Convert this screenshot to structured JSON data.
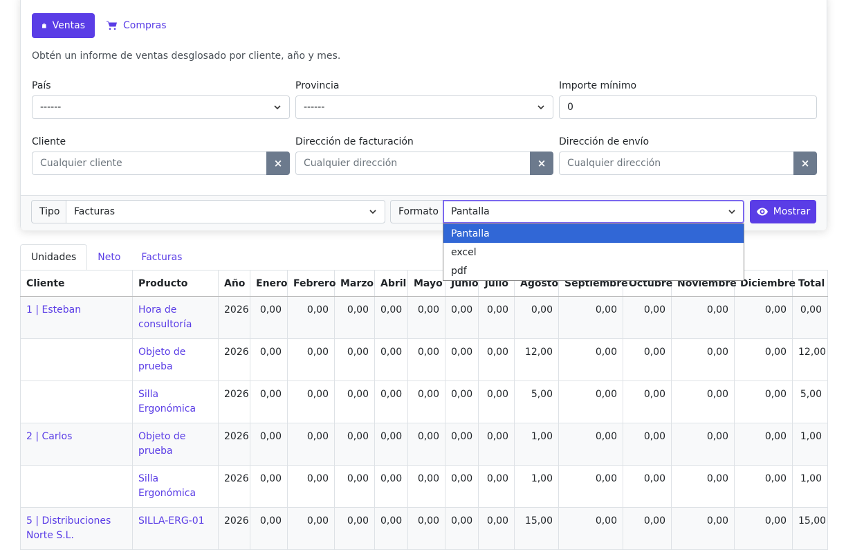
{
  "toolbar": {
    "sales_label": "Ventas",
    "purchases_label": "Compras"
  },
  "description": "Obtén un informe de ventas desglosado por cliente, año y mes.",
  "filters": {
    "country": {
      "label": "País",
      "value": "------"
    },
    "province": {
      "label": "Provincia",
      "value": "------"
    },
    "min_amount": {
      "label": "Importe mínimo",
      "value": "0"
    },
    "customer": {
      "label": "Cliente",
      "placeholder": "Cualquier cliente"
    },
    "billing_address": {
      "label": "Dirección de facturación",
      "placeholder": "Cualquier dirección"
    },
    "shipping_address": {
      "label": "Dirección de envío",
      "placeholder": "Cualquier dirección"
    },
    "clear_symbol": "×"
  },
  "options_bar": {
    "type_label": "Tipo",
    "type_value": "Facturas",
    "format_label": "Formato",
    "format_value": "Pantalla",
    "show_label": "Mostrar",
    "format_options": [
      "Pantalla",
      "excel",
      "pdf"
    ]
  },
  "tabs": [
    "Unidades",
    "Neto",
    "Facturas"
  ],
  "table": {
    "headers": [
      "Cliente",
      "Producto",
      "Año",
      "Enero",
      "Febrero",
      "Marzo",
      "Abril",
      "Mayo",
      "Junio",
      "Julio",
      "Agosto",
      "Septiembre",
      "Octubre",
      "Noviembre",
      "Diciembre",
      "Total"
    ],
    "rows": [
      {
        "cliente": "1 | Esteban",
        "producto": "Hora de consultoría",
        "year": "2026",
        "months": [
          "0,00",
          "0,00",
          "0,00",
          "0,00",
          "0,00",
          "0,00",
          "0,00",
          "0,00",
          "0,00",
          "0,00",
          "0,00",
          "0,00"
        ],
        "total": "0,00"
      },
      {
        "cliente": "",
        "producto": "Objeto de prueba",
        "year": "2026",
        "months": [
          "0,00",
          "0,00",
          "0,00",
          "0,00",
          "0,00",
          "0,00",
          "0,00",
          "12,00",
          "0,00",
          "0,00",
          "0,00",
          "0,00"
        ],
        "total": "12,00"
      },
      {
        "cliente": "",
        "producto": "Silla Ergonómica",
        "year": "2026",
        "months": [
          "0,00",
          "0,00",
          "0,00",
          "0,00",
          "0,00",
          "0,00",
          "0,00",
          "5,00",
          "0,00",
          "0,00",
          "0,00",
          "0,00"
        ],
        "total": "5,00"
      },
      {
        "cliente": "2 | Carlos",
        "producto": "Objeto de prueba",
        "year": "2026",
        "months": [
          "0,00",
          "0,00",
          "0,00",
          "0,00",
          "0,00",
          "0,00",
          "0,00",
          "1,00",
          "0,00",
          "0,00",
          "0,00",
          "0,00"
        ],
        "total": "1,00"
      },
      {
        "cliente": "",
        "producto": "Silla Ergonómica",
        "year": "2026",
        "months": [
          "0,00",
          "0,00",
          "0,00",
          "0,00",
          "0,00",
          "0,00",
          "0,00",
          "1,00",
          "0,00",
          "0,00",
          "0,00",
          "0,00"
        ],
        "total": "1,00"
      },
      {
        "cliente": "5 | Distribuciones Norte S.L.",
        "producto": "SILLA-ERG-01",
        "year": "2026",
        "months": [
          "0,00",
          "0,00",
          "0,00",
          "0,00",
          "0,00",
          "0,00",
          "0,00",
          "15,00",
          "0,00",
          "0,00",
          "0,00",
          "0,00"
        ],
        "total": "15,00"
      }
    ]
  },
  "colors": {
    "accent": "#5a3de6",
    "selected_option": "#3167d6",
    "clear_button": "#6c7a8d"
  },
  "icons": {
    "sales": "shopping-bag-icon",
    "purchases": "shopping-cart-icon",
    "show": "eye-icon",
    "select": "chevron-down-icon"
  }
}
